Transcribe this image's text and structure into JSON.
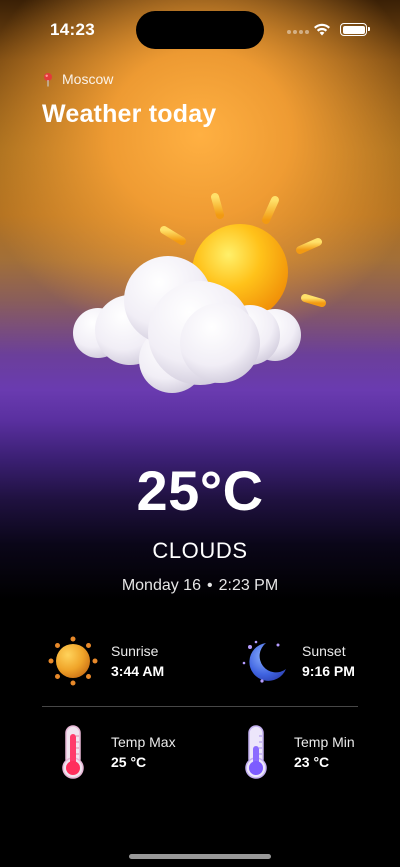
{
  "status_bar": {
    "time": "14:23"
  },
  "header": {
    "location": "Moscow",
    "title": "Weather today"
  },
  "weather": {
    "temperature": "25°C",
    "condition": "CLOUDS",
    "day": "Monday 16",
    "time": "2:23 PM",
    "illustration": "sun-behind-cloud-icon"
  },
  "stats": {
    "sunrise": {
      "label": "Sunrise",
      "value": "3:44 AM",
      "icon": "sun-icon"
    },
    "sunset": {
      "label": "Sunset",
      "value": "9:16 PM",
      "icon": "moon-icon"
    },
    "temp_max": {
      "label": "Temp Max",
      "value": "25 °C",
      "icon": "thermometer-hot-icon"
    },
    "temp_min": {
      "label": "Temp Min",
      "value": "23 °C",
      "icon": "thermometer-cold-icon"
    }
  },
  "colors": {
    "accent_orange": "#f5a441",
    "accent_purple": "#6a3bb0",
    "background": "#000000"
  }
}
